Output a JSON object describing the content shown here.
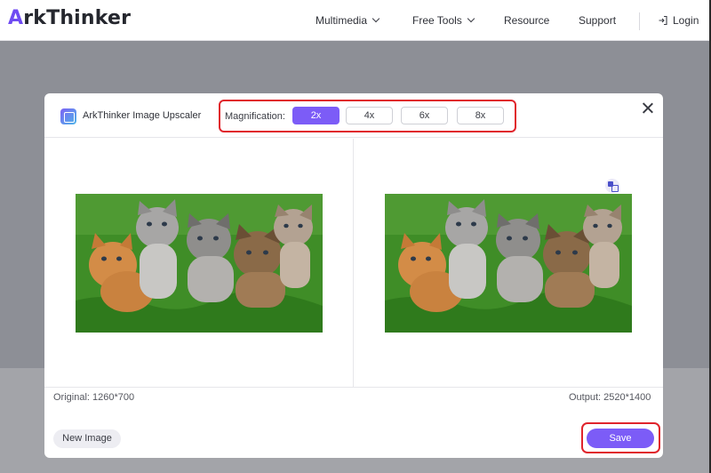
{
  "site": {
    "brand_initial": "A",
    "brand_rest": "rkThinker",
    "nav": [
      "Multimedia",
      "Free Tools",
      "Resource",
      "Support"
    ],
    "login_label": "Login"
  },
  "dialog": {
    "title": "ArkThinker Image Upscaler",
    "magnification_label": "Magnification:",
    "magnification_options": [
      "2x",
      "4x",
      "6x",
      "8x"
    ],
    "selected_magnification": "2x",
    "original_text": "Original: 1260*700",
    "output_text": "Output: 2520*1400",
    "new_image_label": "New Image",
    "save_label": "Save"
  },
  "colors": {
    "accent": "#7c5cf7",
    "highlight": "#e0242c",
    "overlay": "#8d8f96"
  },
  "icons": [
    "chevron-down-icon",
    "login-icon",
    "app-icon",
    "close-icon",
    "compare-icon"
  ]
}
